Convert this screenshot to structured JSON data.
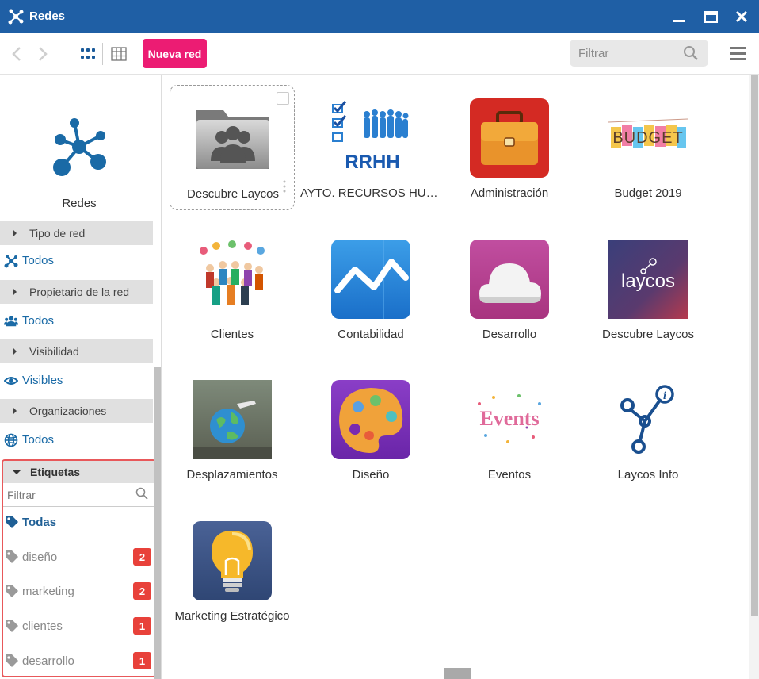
{
  "window": {
    "title": "Redes"
  },
  "toolbar": {
    "new_label": "Nueva red",
    "filter_placeholder": "Filtrar"
  },
  "sidebar": {
    "app_name": "Redes",
    "sections": [
      {
        "header": "Tipo de red",
        "value": "Todos",
        "value_icon": "network-icon"
      },
      {
        "header": "Propietario de la red",
        "value": "Todos",
        "value_icon": "users-icon"
      },
      {
        "header": "Visibilidad",
        "value": "Visibles",
        "value_icon": "eye-icon"
      },
      {
        "header": "Organizaciones",
        "value": "Todos",
        "value_icon": "globe-icon"
      }
    ],
    "tags": {
      "header": "Etiquetas",
      "filter_placeholder": "Filtrar",
      "all_label": "Todas",
      "items": [
        {
          "label": "diseño",
          "count": "2"
        },
        {
          "label": "marketing",
          "count": "2"
        },
        {
          "label": "clientes",
          "count": "1"
        },
        {
          "label": "desarrollo",
          "count": "1"
        }
      ]
    }
  },
  "networks": [
    {
      "name": "Descubre Laycos",
      "icon": "folder-users-icon"
    },
    {
      "name": "AYTO. RECURSOS HUMANOS",
      "icon": "rrhh-icon"
    },
    {
      "name": "Administración",
      "icon": "briefcase-icon"
    },
    {
      "name": "Budget 2019",
      "icon": "budget-icon"
    },
    {
      "name": "Clientes",
      "icon": "people-crowd-icon"
    },
    {
      "name": "Contabilidad",
      "icon": "line-chart-icon"
    },
    {
      "name": "Desarrollo",
      "icon": "cloud-icon"
    },
    {
      "name": "Descubre Laycos",
      "icon": "laycos-logo-icon"
    },
    {
      "name": "Desplazamientos",
      "icon": "globe-travel-icon"
    },
    {
      "name": "Diseño",
      "icon": "palette-icon"
    },
    {
      "name": "Eventos",
      "icon": "events-icon"
    },
    {
      "name": "Laycos Info",
      "icon": "laycos-info-icon"
    },
    {
      "name": "Marketing Estratégico",
      "icon": "lightbulb-icon"
    }
  ],
  "colors": {
    "titlebar": "#1f5fa5",
    "accent": "#ec1c73",
    "badge": "#e8413a",
    "link": "#1a6aa6"
  }
}
